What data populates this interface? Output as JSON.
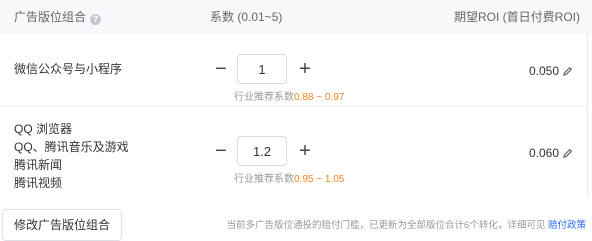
{
  "header": {
    "placement_group": "广告版位组合",
    "coefficient": "系数 (0.01~5)",
    "expected_roi": "期望ROI (首日付费ROI)"
  },
  "rows": [
    {
      "placements": [
        "微信公众号与小程序"
      ],
      "coefficient": "1",
      "hint_label": "行业推荐系数",
      "hint_range": "0.88 ~ 0.97",
      "roi": "0.050"
    },
    {
      "placements": [
        "QQ 浏览器",
        "QQ、腾讯音乐及游戏",
        "腾讯新闻",
        "腾讯视频"
      ],
      "coefficient": "1.2",
      "hint_label": "行业推荐系数",
      "hint_range": "0.95 ~ 1.05",
      "roi": "0.060"
    }
  ],
  "footer": {
    "modify_button": "修改广告版位组合",
    "notice": "当前多广告版位通投的赔付门槛，已更新为全部版位合计6个转化，详细可见",
    "policy_link": "赔付政策"
  },
  "colors": {
    "accent_orange": "#f5841f",
    "link_blue": "#2a6ae9",
    "header_bg": "#f7f8fa"
  }
}
